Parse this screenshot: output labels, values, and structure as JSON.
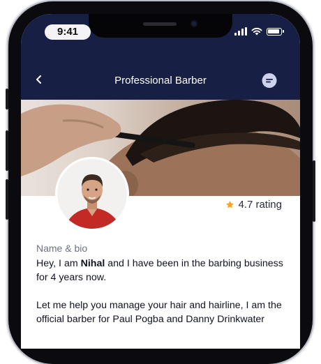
{
  "status_bar": {
    "time": "9:41"
  },
  "header": {
    "title": "Professional Barber"
  },
  "rating": {
    "value": "4.7",
    "text": "4.7 rating"
  },
  "bio": {
    "label": "Name & bio",
    "line1_prefix": "Hey, I am ",
    "name": "Nihal",
    "line1_suffix": " and I have been in the barbing business for 4 years now.",
    "paragraph2": "Let me help you manage your hair and hairline, I am the official barber for Paul Pogba and Danny Drinkwater"
  },
  "colors": {
    "header_bg": "#171f45",
    "star": "#f5a623",
    "chat_icon_bg": "#cdd3ee"
  },
  "icons": [
    "back-chevron-icon",
    "chat-icon",
    "star-icon",
    "signal-icon",
    "wifi-icon",
    "battery-icon"
  ]
}
